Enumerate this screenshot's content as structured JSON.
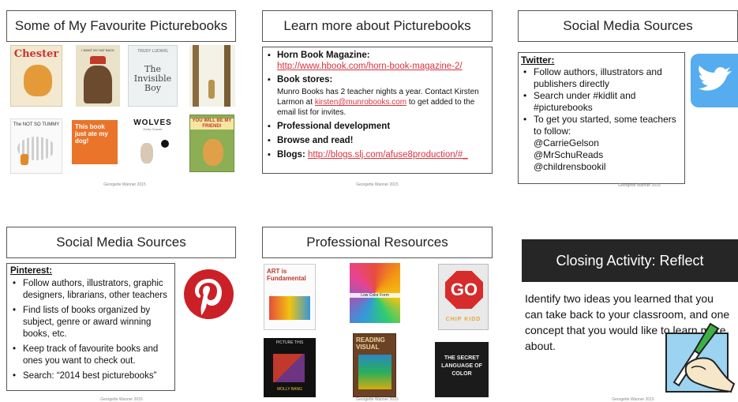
{
  "slides": {
    "favourites": {
      "title": "Some of My Favourite Picturebooks",
      "footer": "Georgette Wanner 2015",
      "books": [
        {
          "cover_text": "Chester",
          "icon": "cat-book-cover"
        },
        {
          "cover_text": "I WANT MY HAT BACK",
          "icon": "bear-book-cover"
        },
        {
          "cover_text": "The Invisible Boy",
          "author": "TRUDY LUDWIG",
          "icon": "boy-book-cover"
        },
        {
          "cover_text": "",
          "icon": "trees-book-cover"
        },
        {
          "cover_text": "The NOT SO TUMMY",
          "icon": "cartoon-book-cover"
        },
        {
          "cover_text": "This book just ate my dog!",
          "icon": "dog-book-cover"
        },
        {
          "cover_text": "WOLVES",
          "author": "Emily Gravett",
          "icon": "rabbit-book-cover"
        },
        {
          "cover_text": "YOU WILL BE MY FRIEND!",
          "icon": "bear-friend-book-cover"
        }
      ]
    },
    "learn": {
      "title": "Learn more about Picturebooks",
      "footer": "Georgette Wanner 2015",
      "horn_label": "Horn Book Magazine:",
      "horn_link": "http://www.hbook.com/horn-book-magazine-2/",
      "stores_label": "Book stores:",
      "stores_text_1": "Munro Books has 2 teacher nights a year.  Contact Kirsten Larmon at",
      "stores_email": "kirsten@munrobooks.com",
      "stores_text_2": "to get added to the email list for invites.",
      "pd_label": "Professional development",
      "browse_label": "Browse and read!",
      "blogs_label": "Blogs:",
      "blogs_link": "http://blogs.slj.com/afuse8production/#_"
    },
    "twitter": {
      "title": "Social Media Sources",
      "footer": "Georgette Wanner 2015",
      "heading": "Twitter:",
      "items": [
        "Follow authors, illustrators and publishers directly",
        "Search under #kidlit and #picturebooks",
        "To get you started, some teachers to follow:"
      ],
      "handles": [
        "@CarrieGelson",
        "@MrSchuReads",
        "@childrensbookil"
      ],
      "icon": "twitter-bird-icon"
    },
    "pinterest": {
      "title": "Social Media Sources",
      "footer": "Georgette Wanner 2015",
      "heading": "Pinterest:",
      "items": [
        "Follow authors, illustrators, graphic designers, librarians, other teachers",
        "Find lists of books organized by subject, genre or award winning books, etc.",
        "Keep track of favourite books and ones you want to check out.",
        "Search: “2014 best picturebooks”"
      ],
      "icon": "pinterest-logo-icon"
    },
    "resources": {
      "title": "Professional Resources",
      "footer": "Georgette Wanner 2015",
      "books": [
        {
          "cover_text": "ART is Fundamental"
        },
        {
          "cover_text": "Low Color Form"
        },
        {
          "cover_text": "GO",
          "author": "CHIP KIDD"
        },
        {
          "cover_text": "PICTURE THIS",
          "author": "MOLLY BANG"
        },
        {
          "cover_text": "READING VISUAL"
        },
        {
          "cover_text": "THE SECRET LANGUAGE OF COLOR"
        }
      ]
    },
    "reflect": {
      "title": "Closing Activity: Reflect",
      "footer": "Georgette Wanner 2015",
      "text": "Identify two ideas you learned that you can take back to your classroom, and one concept that you would like to learn more about.",
      "icon": "hand-writing-icon"
    }
  },
  "colors": {
    "twitter_blue": "#55acee",
    "pinterest_red": "#cb2027",
    "link_red": "#d9333f",
    "reflect_bar": "#262626"
  }
}
